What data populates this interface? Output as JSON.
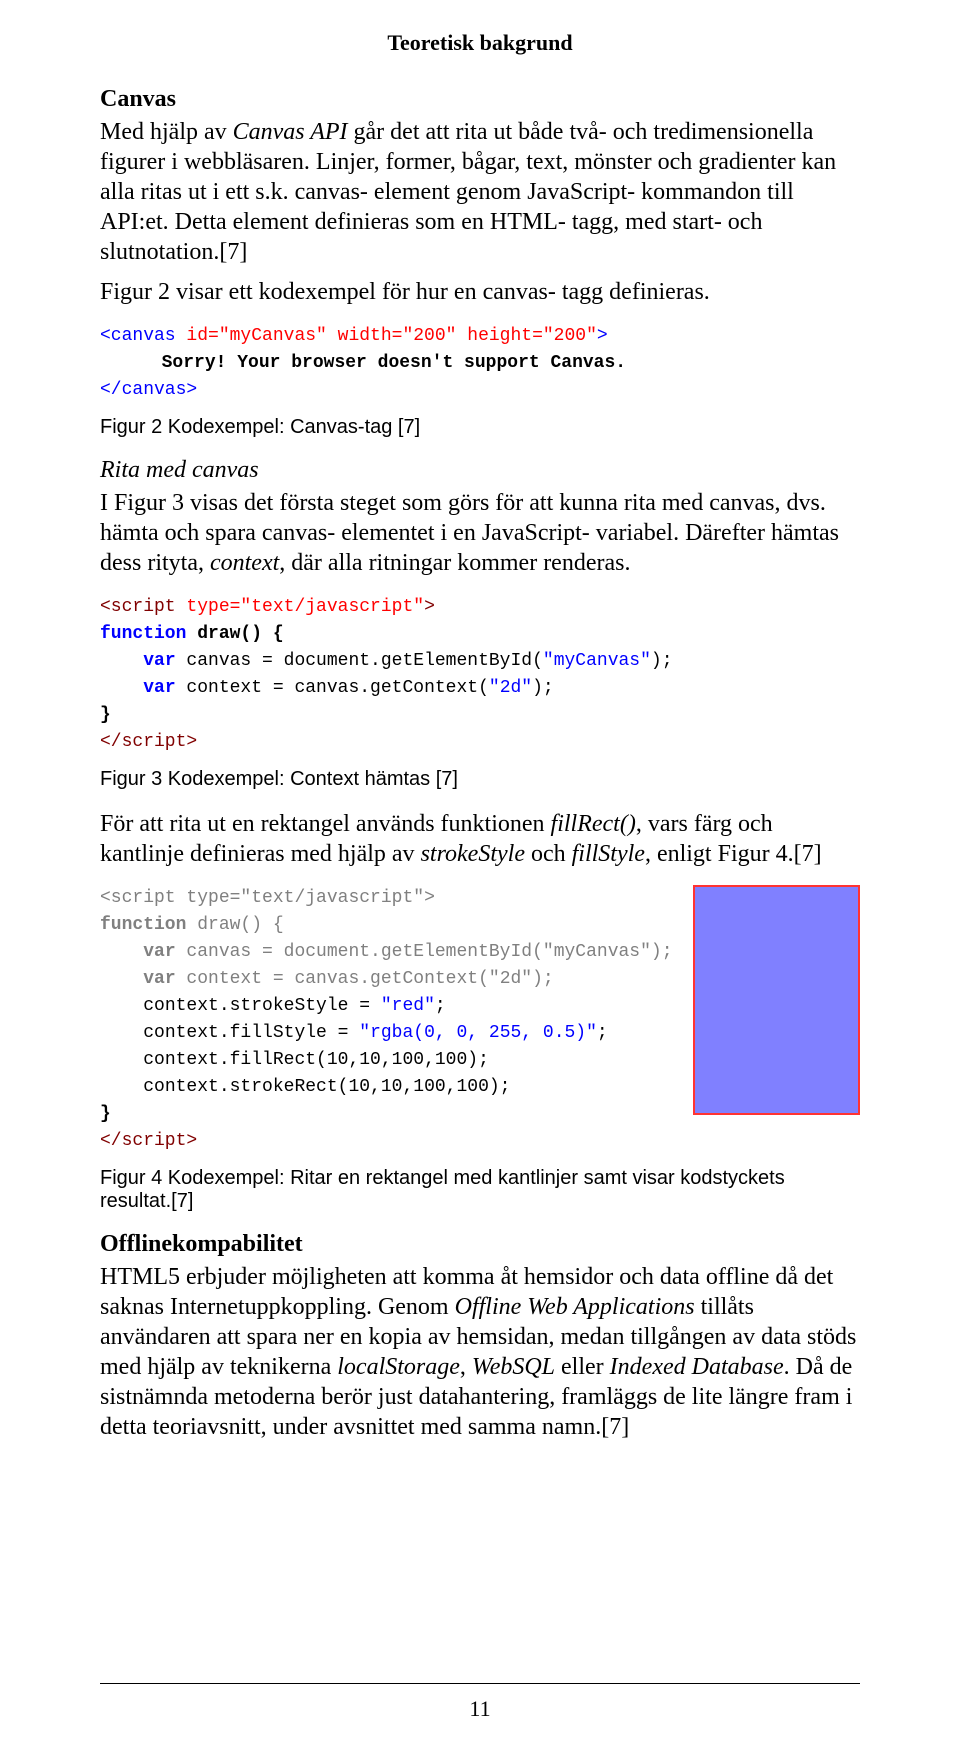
{
  "runningHead": "Teoretisk bakgrund",
  "sections": {
    "canvas": {
      "title": "Canvas",
      "p1_a": "Med hjälp av ",
      "p1_it1": "Canvas API",
      "p1_b": " går det att rita ut både två- och tredimensionella figurer i webbläsaren. Linjer, former, bågar, text, mönster och gradienter kan alla ritas ut i ett s.k. canvas- element genom JavaScript- kommandon till API:et. Detta element definieras som en HTML- tagg, med start- och slutnotation.[7]",
      "p2": "Figur 2 visar ett kodexempel för hur en canvas- tagg definieras."
    },
    "fig2": {
      "line1_open": "<canvas ",
      "line1_attrs": "id=\"myCanvas\" width=\"200\" height=\"200\"",
      "line1_close": ">",
      "line2": "Sorry! Your browser doesn't support Canvas.",
      "line3": "</canvas>",
      "caption": "Figur 2 Kodexempel: Canvas-tag [7]"
    },
    "rita": {
      "heading": "Rita med canvas",
      "p_a": "I Figur 3 visas det första steget som görs för att kunna rita med canvas, dvs. hämta och spara canvas- elementet i en JavaScript- variabel. Därefter hämtas dess rityta, ",
      "p_it": "context",
      "p_b": ", där alla ritningar kommer renderas."
    },
    "fig3": {
      "l1_a": "<script ",
      "l1_b": "type=\"text/javascript\"",
      "l1_c": ">",
      "l2_a": "function",
      "l2_b": " draw() {",
      "l3_a": "var",
      "l3_b": " canvas = document.getElementById(",
      "l3_c": "\"myCanvas\"",
      "l3_d": ");",
      "l4_a": "var",
      "l4_b": " context = canvas.getContext(",
      "l4_c": "\"2d\"",
      "l4_d": ");",
      "l5": "}",
      "l6": "</script>",
      "caption": "Figur 3 Kodexempel: Context hämtas [7]"
    },
    "midpara": {
      "a": "För att rita ut en rektangel används funktionen ",
      "it1": "fillRect()",
      "b": ", vars färg och kantlinje definieras med hjälp av ",
      "it2": "strokeStyle",
      "c": " och ",
      "it3": "fillStyle",
      "d": ", enligt Figur 4.[7]"
    },
    "fig4": {
      "l1_a": "<script ",
      "l1_b": "type=\"text/javascript\"",
      "l1_c": ">",
      "l2_a": "function",
      "l2_b": " draw() {",
      "l3_a": "var",
      "l3_b": " canvas = document.getElementById(",
      "l3_c": "\"myCanvas\"",
      "l3_d": ");",
      "l4_a": "var",
      "l4_b": " context = canvas.getContext(",
      "l4_c": "\"2d\"",
      "l4_d": ");",
      "l5_a": "context.strokeStyle = ",
      "l5_b": "\"red\"",
      "l5_c": ";",
      "l6_a": "context.fillStyle = ",
      "l6_b": "\"rgba(0, 0, 255, 0.5)\"",
      "l6_c": ";",
      "l7": "context.fillRect(10,10,100,100);",
      "l8": "context.strokeRect(10,10,100,100);",
      "l9": "}",
      "l10": "</script>",
      "caption": "Figur 4 Kodexempel: Ritar en rektangel med kantlinjer samt visar kodstyckets resultat.[7]"
    },
    "offline": {
      "title": "Offlinekompabilitet",
      "a": "HTML5 erbjuder möjligheten att komma åt hemsidor och data offline då det saknas Internetuppkoppling. Genom ",
      "it1": "Offline Web Applications",
      "b": " tillåts användaren att spara ner en kopia av hemsidan, medan tillgången av data stöds med hjälp av teknikerna ",
      "it2": "localStorage",
      "c": ", ",
      "it3": "WebSQL",
      "d": " eller ",
      "it4": "Indexed Database",
      "e": ". Då de sistnämnda metoderna berör just datahantering, framläggs de lite längre fram i detta teoriavsnitt, under avsnittet med samma namn.[7]"
    }
  },
  "pageNumber": "11"
}
